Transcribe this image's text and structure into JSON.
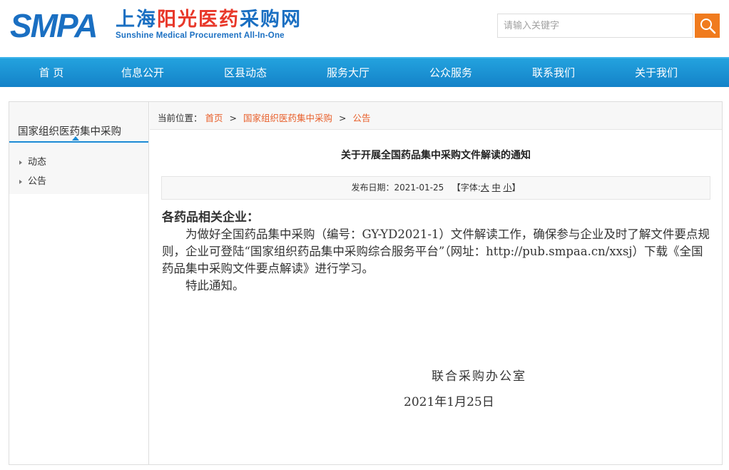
{
  "header": {
    "logo_mark": "SMPA",
    "logo_cn_a": "上海",
    "logo_cn_b": "阳光医药",
    "logo_cn_c": "采购网",
    "logo_en": "Sunshine Medical Procurement All-In-One",
    "search_placeholder": "请输入关键字",
    "search_icon": "search-icon",
    "accent_color": "#f07b1e",
    "brand_color": "#1a6fc2"
  },
  "nav": {
    "items": [
      "首 页",
      "信息公开",
      "区县动态",
      "服务大厅",
      "公众服务",
      "联系我们",
      "关于我们"
    ]
  },
  "sidebar": {
    "title": "国家组织医药集中采购",
    "items": [
      "动态",
      "公告"
    ]
  },
  "breadcrumb": {
    "label": "当前位置：",
    "items": [
      "首页",
      "国家组织医药集中采购",
      "公告"
    ],
    "separator": ">"
  },
  "article": {
    "title": "关于开展全国药品集中采购文件解读的通知",
    "publish_label": "发布日期：2021-01-25",
    "font_label_open": "【字体:",
    "font_sizes": [
      "大",
      "中",
      "小"
    ],
    "font_label_close": "】",
    "salutation": "各药品相关企业：",
    "paragraph": "为做好全国药品集中采购（编号：GY-YD2021-1）文件解读工作，确保参与企业及时了解文件要点规则，企业可登陆“国家组织药品集中采购综合服务平台”（网址：http://pub.smpaa.cn/xxsj）下载《全国药品集中采购文件要点解读》进行学习。",
    "closing": "特此通知。",
    "signature": "联合采购办公室",
    "date": "2021年1月25日"
  }
}
